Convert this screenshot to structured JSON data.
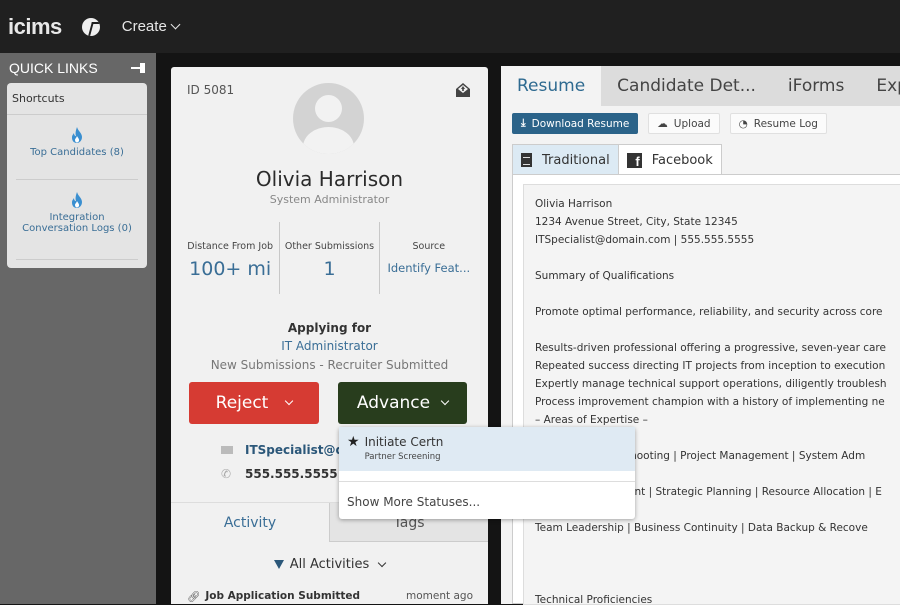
{
  "topbar": {
    "logo": "icims",
    "create_label": "Create"
  },
  "quick_links": {
    "title": "QUICK LINKS",
    "shortcuts_title": "Shortcuts",
    "items": [
      {
        "label": "Top Candidates (8)",
        "icon": "flame-icon"
      },
      {
        "label": "Integration Conversation Logs (0)",
        "icon": "flame-icon"
      }
    ]
  },
  "candidate": {
    "id": "ID 5081",
    "name": "Olivia Harrison",
    "role": "System Administrator",
    "stats": [
      {
        "label": "Distance From Job",
        "value": "100+ mi"
      },
      {
        "label": "Other Submissions",
        "value": "1"
      },
      {
        "label": "Source",
        "value": "Identify Feat..."
      }
    ],
    "applying_label": "Applying for",
    "job": "IT Administrator",
    "status": "New Submissions - Recruiter Submitted",
    "reject_label": "Reject",
    "advance_label": "Advance",
    "email": "ITSpecialist@do",
    "phone": "555.555.5555",
    "tabs": [
      "Activity",
      "Tags"
    ],
    "filter_label": "All Activities",
    "activity": {
      "label": "Job Application Submitted",
      "time": "moment ago"
    }
  },
  "dropdown": {
    "item_title": "Initiate Certn",
    "item_subtitle": "Partner Screening",
    "more_label": "Show More Statuses..."
  },
  "resume_panel": {
    "tabs": [
      "Resume",
      "Candidate Det...",
      "iForms",
      "Exp"
    ],
    "toolbar": {
      "download": "Download Resume",
      "upload": "Upload",
      "log": "Resume Log"
    },
    "subtabs": [
      "Traditional",
      "Facebook"
    ],
    "lines": [
      "Olivia Harrison",
      "1234 Avenue Street, City, State 12345",
      "ITSpecialist@domain.com | 555.555.5555",
      "",
      "Summary of Qualifications",
      "",
      "Promote optimal performance, reliability, and security across core",
      "",
      "Results-driven professional offering a progressive, seven-year care",
      "Repeated success directing IT projects from inception to execution",
      "Expertly manage technical support operations, diligently troublesh",
      "Process improvement champion with a history of implementing ne",
      "– Areas of Expertise –",
      "",
      "Technical Troubleshooting  |  Project Management  |  System Adm",
      "",
      "Budget Management  |  Strategic Planning  |  Resource Allocation  |  E",
      "",
      "Team Leadership  |  Business Continuity  |  Data Backup & Recove",
      "",
      "",
      "",
      "Technical Proficiencies"
    ]
  }
}
